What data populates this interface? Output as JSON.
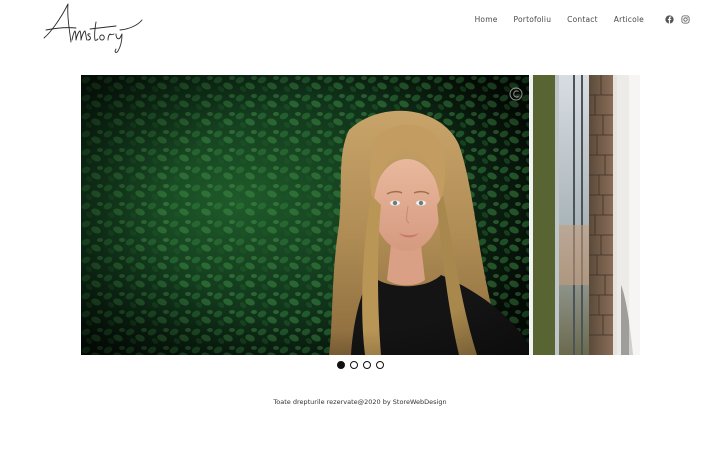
{
  "brand": {
    "logo_text": "Amstory",
    "logo_icon": "script-signature-logo"
  },
  "nav": {
    "items": [
      {
        "label": "Home"
      },
      {
        "label": "Portofoliu"
      },
      {
        "label": "Contact"
      },
      {
        "label": "Articole"
      }
    ],
    "social": [
      {
        "icon": "facebook-icon"
      },
      {
        "icon": "instagram-icon"
      }
    ]
  },
  "slider": {
    "slide_count": 4,
    "active_index": 0,
    "photo_subject": "portrait-girl-long-blonde-hair-ivy-background",
    "watermark_icon": "copyright-watermark-icon"
  },
  "footer": {
    "text": "Toate drepturile rezervate@2020 by StoreWebDesign"
  },
  "colors": {
    "text": "#4a4a4a",
    "footer_text": "#333333",
    "dot_active": "#111111",
    "background": "#ffffff"
  }
}
